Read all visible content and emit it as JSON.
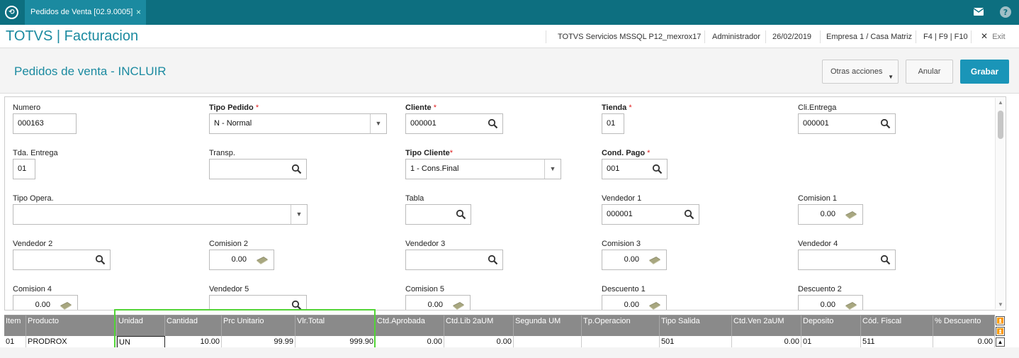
{
  "topbar": {
    "tab_title": "Pedidos de Venta [02.9.0005]",
    "tab_close": "×",
    "mail_icon": "mail-icon",
    "help_icon": "help-icon"
  },
  "appbar": {
    "app_name": "TOTVS | Facturacion",
    "environment": "TOTVS Servicios MSSQL P12_mexrox17",
    "user": "Administrador",
    "date": "26/02/2019",
    "company": "Empresa 1 / Casa Matriz",
    "shortcuts": "F4 | F9 | F10",
    "exit_label": "Exit"
  },
  "page": {
    "title": "Pedidos de venta - INCLUIR",
    "more_actions": "Otras acciones",
    "cancel": "Anular",
    "save": "Grabar"
  },
  "form": {
    "numero": {
      "label": "Numero",
      "value": "000163"
    },
    "tipo_pedido": {
      "label": "Tipo Pedido",
      "value": "N - Normal"
    },
    "cliente": {
      "label": "Cliente",
      "value": "000001"
    },
    "tienda": {
      "label": "Tienda",
      "value": "01"
    },
    "cli_entrega": {
      "label": "Cli.Entrega",
      "value": "000001"
    },
    "tda_entrega": {
      "label": "Tda. Entrega",
      "value": "01"
    },
    "transp": {
      "label": "Transp.",
      "value": ""
    },
    "tipo_cliente": {
      "label": "Tipo Cliente",
      "value": "1 - Cons.Final"
    },
    "cond_pago": {
      "label": "Cond. Pago",
      "value": "001"
    },
    "tipo_opera": {
      "label": "Tipo Opera.",
      "value": ""
    },
    "tabla": {
      "label": "Tabla",
      "value": ""
    },
    "vendedor1": {
      "label": "Vendedor 1",
      "value": "000001"
    },
    "comision1": {
      "label": "Comision 1",
      "value": "0.00"
    },
    "vendedor2": {
      "label": "Vendedor 2",
      "value": ""
    },
    "comision2": {
      "label": "Comision 2",
      "value": "0.00"
    },
    "vendedor3": {
      "label": "Vendedor 3",
      "value": ""
    },
    "comision3": {
      "label": "Comision 3",
      "value": "0.00"
    },
    "vendedor4": {
      "label": "Vendedor 4",
      "value": ""
    },
    "comision4": {
      "label": "Comision 4",
      "value": "0.00"
    },
    "vendedor5": {
      "label": "Vendedor 5",
      "value": ""
    },
    "comision5": {
      "label": "Comision 5",
      "value": "0.00"
    },
    "descuento1": {
      "label": "Descuento 1",
      "value": "0.00"
    },
    "descuento2": {
      "label": "Descuento 2",
      "value": "0.00"
    },
    "required_mark": "*"
  },
  "grid": {
    "columns": [
      "Item",
      "Producto",
      "Unidad",
      "Cantidad",
      "Prc Unitario",
      "Vlr.Total",
      "Ctd.Aprobada",
      "Ctd.Lib 2aUM",
      "Segunda UM",
      "Tp.Operacion",
      "Tipo Salida",
      "Ctd.Ven 2aUM",
      "Deposito",
      "Cód. Fiscal",
      "% Descuento"
    ],
    "rows": [
      [
        "01",
        "PRODROX",
        "UN",
        "10.00",
        "99.99",
        "999.90",
        "0.00",
        "0.00",
        "",
        "",
        "501",
        "0.00",
        "01",
        "511",
        "0.00"
      ]
    ]
  },
  "colors": {
    "topbar": "#0d6f80",
    "accent": "#1b8aa0",
    "primary_button": "#1a95b8",
    "highlight": "#52d436",
    "grid_header": "#8a8a8a"
  }
}
